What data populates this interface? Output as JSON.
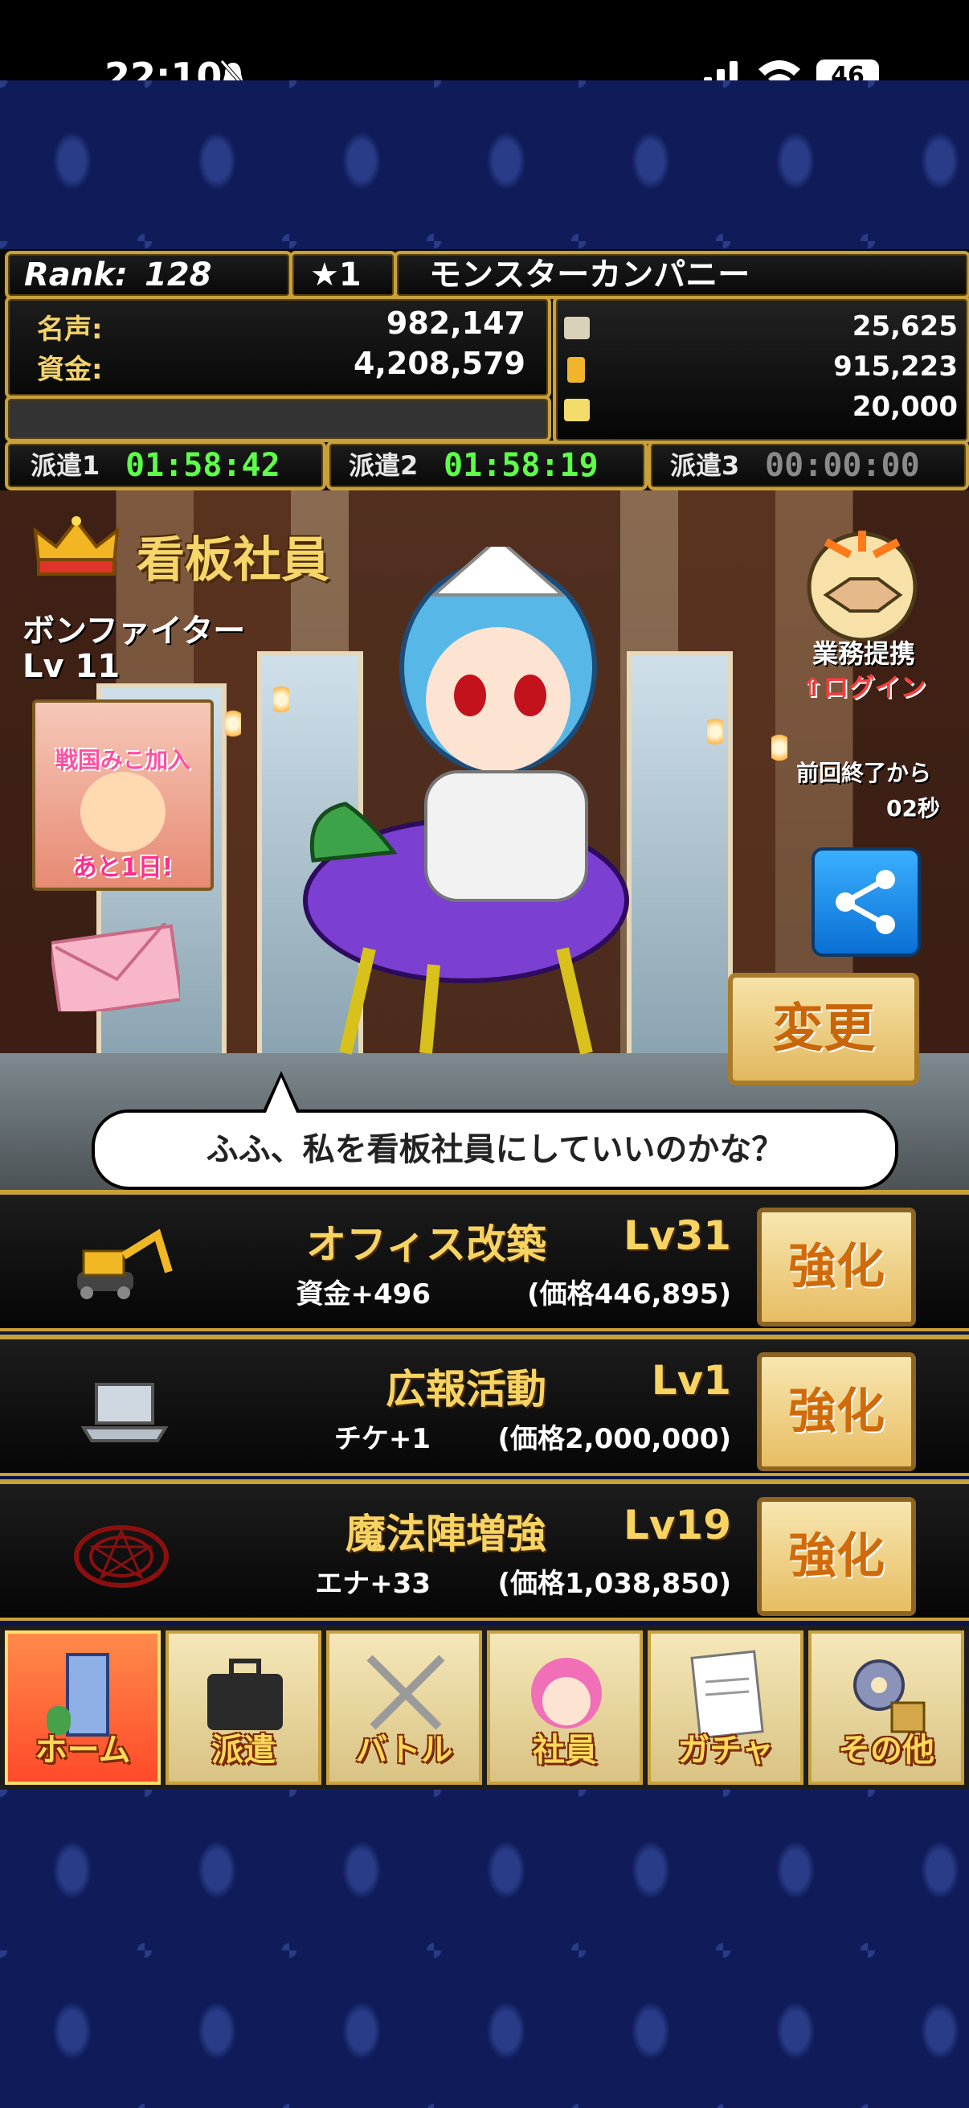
{
  "status_bar": {
    "time": "22:10",
    "battery": "46"
  },
  "header": {
    "rank_label": "Rank:",
    "rank_value": "128",
    "stars": "★1",
    "company_name": "モンスターカンパニー",
    "fame_label": "名声:",
    "fame_value": "982,147",
    "funds_label": "資金:",
    "funds_value": "4,208,579",
    "resources": [
      "25,625",
      "915,223",
      "20,000"
    ]
  },
  "dispatch": [
    {
      "label": "派遣1",
      "time": "01:58:42",
      "color": "#5dff4a"
    },
    {
      "label": "派遣2",
      "time": "01:58:19",
      "color": "#5dff4a"
    },
    {
      "label": "派遣3",
      "time": "00:00:00",
      "color": "#8a8a8a"
    }
  ],
  "scene": {
    "title": "看板社員",
    "employee_name": "ボンファイター",
    "employee_level": "Lv 11",
    "event_title": "戦国みこ加入",
    "event_remaining": "あと1日!",
    "partner_label": "業務提携",
    "partner_login": "⇧ログイン",
    "since_label": "前回終了から",
    "since_value": "02秒",
    "change_button": "変更",
    "speech": "ふふ、私を看板社員にしていいのかな？"
  },
  "upgrades": [
    {
      "name": "オフィス改築",
      "effect": "資金+496",
      "level": "Lv31",
      "price": "(価格446,895)",
      "button": "強化",
      "icon": "excavator-icon"
    },
    {
      "name": "広報活動",
      "effect": "チケ+1",
      "level": "Lv1",
      "price": "(価格2,000,000)",
      "button": "強化",
      "icon": "laptop-icon"
    },
    {
      "name": "魔法陣増強",
      "effect": "エナ+33",
      "level": "Lv19",
      "price": "(価格1,038,850)",
      "button": "強化",
      "icon": "magic-circle-icon"
    }
  ],
  "tabs": [
    {
      "label": "ホーム",
      "icon": "building-icon",
      "active": true
    },
    {
      "label": "派遣",
      "icon": "briefcase-icon",
      "active": false
    },
    {
      "label": "バトル",
      "icon": "swords-icon",
      "active": false
    },
    {
      "label": "社員",
      "icon": "employee-icon",
      "active": false
    },
    {
      "label": "ガチャ",
      "icon": "document-icon",
      "active": false
    },
    {
      "label": "その他",
      "icon": "gear-icon",
      "active": false
    }
  ]
}
